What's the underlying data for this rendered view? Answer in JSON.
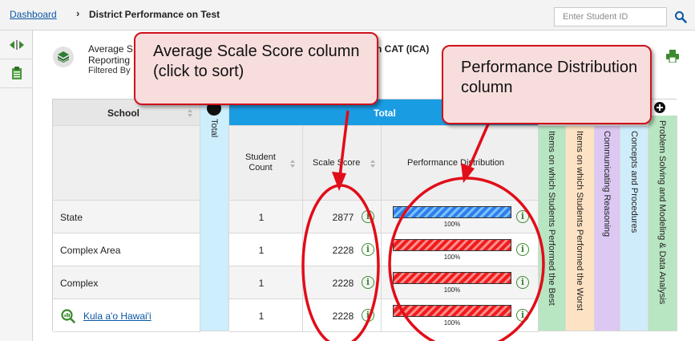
{
  "breadcrumb": {
    "root": "Dashboard",
    "separator": "›",
    "current": "District Performance on Test"
  },
  "search": {
    "placeholder": "Enter Student ID"
  },
  "report": {
    "title": "Average S",
    "reporting": "Reporting",
    "filtered": "Filtered By",
    "assessment": "n CAT (ICA)"
  },
  "table": {
    "header": {
      "school": "School",
      "total_vertical": "Total",
      "total_group": "Total",
      "student_count": "Student Count",
      "scale_score": "Scale Score",
      "performance_distribution": "Performance Distribution"
    },
    "rows": [
      {
        "name": "State",
        "link": false,
        "count": "1",
        "score": "2877",
        "bar_color": "blue",
        "pct": "100%",
        "fill": 1.0
      },
      {
        "name": "Complex Area",
        "link": false,
        "count": "1",
        "score": "2228",
        "bar_color": "red",
        "pct": "100%",
        "fill": 1.0
      },
      {
        "name": "Complex",
        "link": false,
        "count": "1",
        "score": "2228",
        "bar_color": "red",
        "pct": "100%",
        "fill": 1.0
      },
      {
        "name": "Kula a'o Hawai'i",
        "link": true,
        "count": "1",
        "score": "2228",
        "bar_color": "red",
        "pct": "100%",
        "fill": 1.0
      }
    ],
    "side_columns": [
      {
        "label": "Items on which Students Performed the Best",
        "color": "#b9e6c2"
      },
      {
        "label": "Items on which Students Performed the Worst",
        "color": "#fde3c4"
      },
      {
        "label": "Communicating Reasoning",
        "color": "#dcc8f3"
      },
      {
        "label": "Concepts and Procedures",
        "color": "#cfecfb"
      },
      {
        "label": "Problem Solving and Modeling & Data Analysis",
        "color": "#b9e6c2"
      }
    ]
  },
  "annotations": {
    "scale_score_callout": "Average Scale Score column (click to sort)",
    "performance_callout": "Performance Distribution column"
  },
  "colors": {
    "accent_blue": "#1a9ce3",
    "accent_red": "#d0111b",
    "info_green": "#3c8a2f"
  },
  "icons": [
    "search-icon",
    "collapse-arrows-icon",
    "clipboard-icon",
    "book-stack-icon",
    "print-icon",
    "info-icon",
    "magnifier-chart-icon",
    "plus-circle-icon"
  ]
}
